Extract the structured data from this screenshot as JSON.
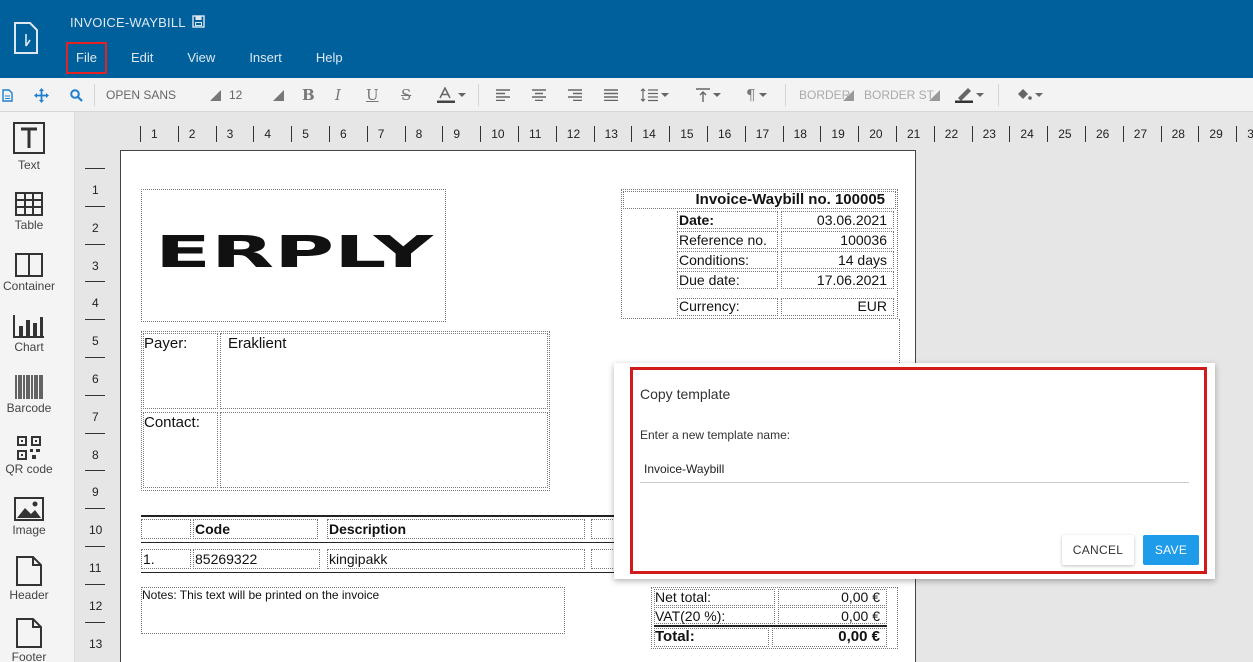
{
  "header": {
    "title": "INVOICE-WAYBILL",
    "menu": [
      "File",
      "Edit",
      "View",
      "Insert",
      "Help"
    ]
  },
  "toolbar": {
    "font_family": "OPEN SANS",
    "font_size": "12",
    "border_width": "BORDER",
    "border_style": "BORDER ST"
  },
  "sidebar": {
    "tools": [
      {
        "label": "Text",
        "icon": "text-icon"
      },
      {
        "label": "Table",
        "icon": "table-icon"
      },
      {
        "label": "Container",
        "icon": "container-icon"
      },
      {
        "label": "Chart",
        "icon": "chart-icon"
      },
      {
        "label": "Barcode",
        "icon": "barcode-icon"
      },
      {
        "label": "QR code",
        "icon": "qr-code-icon"
      },
      {
        "label": "Image",
        "icon": "image-icon"
      },
      {
        "label": "Header",
        "icon": "header-icon"
      },
      {
        "label": "Footer",
        "icon": "footer-icon"
      }
    ]
  },
  "ruler": {
    "horizontal": [
      "1",
      "2",
      "3",
      "4",
      "5",
      "6",
      "7",
      "8",
      "9",
      "10",
      "11",
      "12",
      "13",
      "14",
      "15",
      "16",
      "17",
      "18",
      "19",
      "20",
      "21",
      "22",
      "23",
      "24",
      "25",
      "26",
      "27",
      "28",
      "29",
      "3"
    ],
    "vertical": [
      "1",
      "2",
      "3",
      "4",
      "5",
      "6",
      "7",
      "8",
      "9",
      "10",
      "11",
      "12",
      "13"
    ]
  },
  "invoice": {
    "logo_text": "ERPLY",
    "heading": "Invoice-Waybill no. 100005",
    "meta": [
      {
        "label": "Date:",
        "value": "03.06.2021"
      },
      {
        "label": "Reference no.",
        "value": "100036"
      },
      {
        "label": "Conditions:",
        "value": "14 days"
      },
      {
        "label": "Due date:",
        "value": "17.06.2021"
      },
      {
        "label": "Currency:",
        "value": "EUR"
      }
    ],
    "payer_label": "Payer:",
    "payer_value": "Eraklient",
    "contact_label": "Contact:",
    "table_headers": {
      "code": "Code",
      "description": "Description"
    },
    "row": {
      "num": "1.",
      "code": "85269322",
      "description": "kingipakk"
    },
    "notes": "Notes: This text will be printed on the invoice",
    "totals": [
      {
        "label": "Net total:",
        "value": "0,00 €"
      },
      {
        "label": "VAT(20 %):",
        "value": "0,00 €"
      },
      {
        "label": "Total:",
        "value": "0,00 €"
      }
    ]
  },
  "dialog": {
    "title": "Copy template",
    "label": "Enter a new template name:",
    "input_value": "Invoice-Waybill",
    "cancel": "CANCEL",
    "save": "SAVE"
  },
  "colors": {
    "header": "#00609c",
    "highlight": "#d11a1a",
    "save_button": "#1e9be9"
  }
}
